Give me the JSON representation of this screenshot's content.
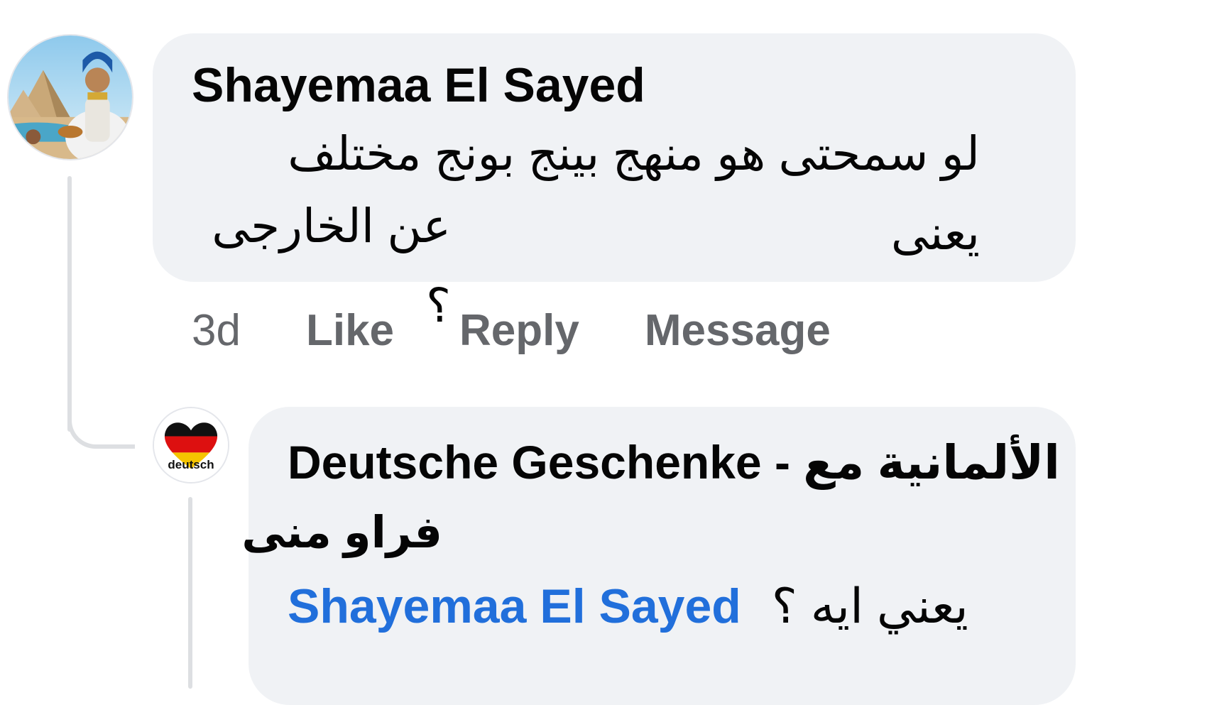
{
  "comments": [
    {
      "author": "Shayemaa El Sayed",
      "text_line1": "لو سمحتى هو منهج بينج بونج مختلف يعنى",
      "text_line2": "عن الخارجى ؟",
      "time": "3d",
      "actions": {
        "like": "Like",
        "reply": "Reply",
        "message": "Message"
      },
      "avatar": "woman-pharaoh-pyramids-avatar"
    },
    {
      "author": "Deutsche Geschenke - الألمانية مع",
      "author_line2": "فراو منى",
      "avatar_label": "deutsch",
      "avatar": "german-flag-heart-avatar",
      "mention": "Shayemaa El Sayed",
      "text": "يعني ايه ؟"
    }
  ],
  "colors": {
    "bubble": "#f0f2f5",
    "mention": "#216fdb",
    "muted": "#65676b",
    "thread_line": "#dddfe2"
  }
}
